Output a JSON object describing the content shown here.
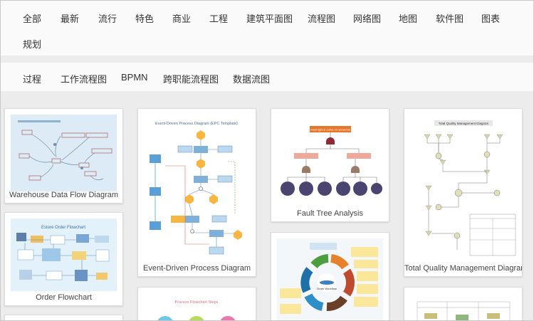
{
  "categories": [
    "全部",
    "最新",
    "流行",
    "特色",
    "商业",
    "工程",
    "建筑平面图",
    "流程图",
    "网络图",
    "地图",
    "软件图",
    "图表",
    "规划"
  ],
  "subcategories": [
    "过程",
    "工作流程图",
    "BPMN",
    "跨职能流程图",
    "数据流图"
  ],
  "cards": [
    {
      "title": "Warehouse Data Flow Diagram"
    },
    {
      "title": "Order Flowchart",
      "thumb_title": "Estore Order Flowchart"
    },
    {
      "title": "Event-Driven Process Diagram",
      "thumb_title": "Event-Driven Process Diagram (EPC Template)"
    },
    {
      "title": "Fault Tree Analysis",
      "thumb_title": "Fault light is come on abnormal"
    },
    {
      "title": "Total Quality Management Diagram",
      "thumb_title": "Total Quality Management Diagram"
    },
    {
      "thumb_title": "Order Workflow"
    },
    {
      "thumb_title": "Process Flowchart Steps"
    }
  ]
}
